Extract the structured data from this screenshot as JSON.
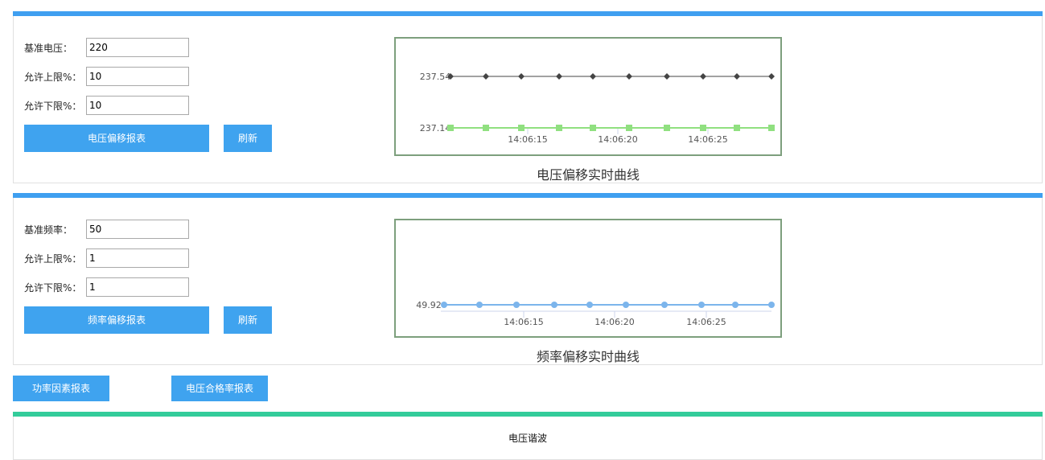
{
  "voltage": {
    "base_label": "基准电压：",
    "base_value": "220",
    "upper_label": "允许上限%：",
    "upper_value": "10",
    "lower_label": "允许下限%：",
    "lower_value": "10",
    "report_button": "电压偏移报表",
    "refresh_button": "刷新",
    "chart_title": "电压偏移实时曲线"
  },
  "frequency": {
    "base_label": "基准频率：",
    "base_value": "50",
    "upper_label": "允许上限%：",
    "upper_value": "1",
    "lower_label": "允许下限%：",
    "lower_value": "1",
    "report_button": "频率偏移报表",
    "refresh_button": "刷新",
    "chart_title": "频率偏移实时曲线"
  },
  "extra_buttons": {
    "power_factor": "功率因素报表",
    "voltage_pass_rate": "电压合格率报表"
  },
  "harmonic": {
    "title": "电压谐波"
  },
  "chart_data": [
    {
      "type": "line",
      "x_ticks": [
        "14:06:15",
        "14:06:20",
        "14:06:25"
      ],
      "y_ticks": [
        "237.54",
        "237.14"
      ],
      "series": [
        {
          "values": [
            237.54,
            237.54,
            237.54,
            237.54,
            237.54,
            237.54,
            237.54,
            237.54,
            237.54,
            237.54
          ],
          "color": "#444444",
          "marker": "diamond"
        },
        {
          "values": [
            237.14,
            237.14,
            237.14,
            237.14,
            237.14,
            237.14,
            237.14,
            237.14,
            237.14,
            237.14
          ],
          "color": "#90e080",
          "marker": "square"
        }
      ]
    },
    {
      "type": "line",
      "x_ticks": [
        "14:06:15",
        "14:06:20",
        "14:06:25"
      ],
      "y_ticks": [
        "49.92"
      ],
      "series": [
        {
          "values": [
            49.92,
            49.92,
            49.92,
            49.92,
            49.92,
            49.92,
            49.92,
            49.92,
            49.92,
            49.92
          ],
          "color": "#7cb5ec",
          "marker": "circle"
        }
      ]
    }
  ]
}
